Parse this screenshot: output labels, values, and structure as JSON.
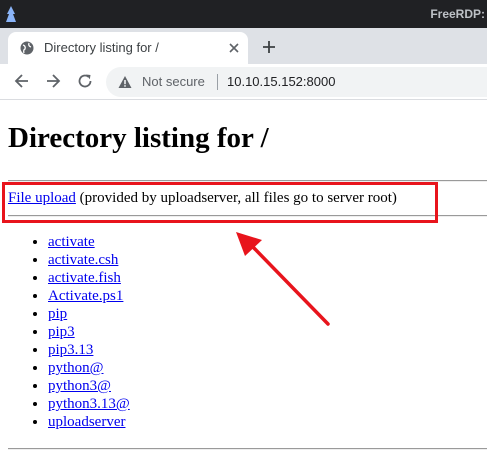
{
  "rdp": {
    "title": "FreeRDP:",
    "app_icon": "kali-dragon-icon"
  },
  "browser": {
    "tab": {
      "favicon": "globe-icon",
      "title": "Directory listing for /"
    },
    "new_tab_icon": "plus-icon",
    "toolbar": {
      "back_icon": "arrow-left-icon",
      "forward_icon": "arrow-right-icon",
      "reload_icon": "reload-icon",
      "security_icon": "warning-triangle-icon",
      "security_text": "Not secure",
      "url": "10.10.15.152:8000"
    }
  },
  "page": {
    "heading": "Directory listing for /",
    "upload_link": "File upload",
    "upload_note": " (provided by uploadserver, all files go to server root)",
    "files": [
      "activate",
      "activate.csh",
      "activate.fish",
      "Activate.ps1",
      "pip",
      "pip3",
      "pip3.13",
      "python@",
      "python3@",
      "python3.13@",
      "uploadserver"
    ]
  },
  "annotation": {
    "color": "#e8141c"
  }
}
